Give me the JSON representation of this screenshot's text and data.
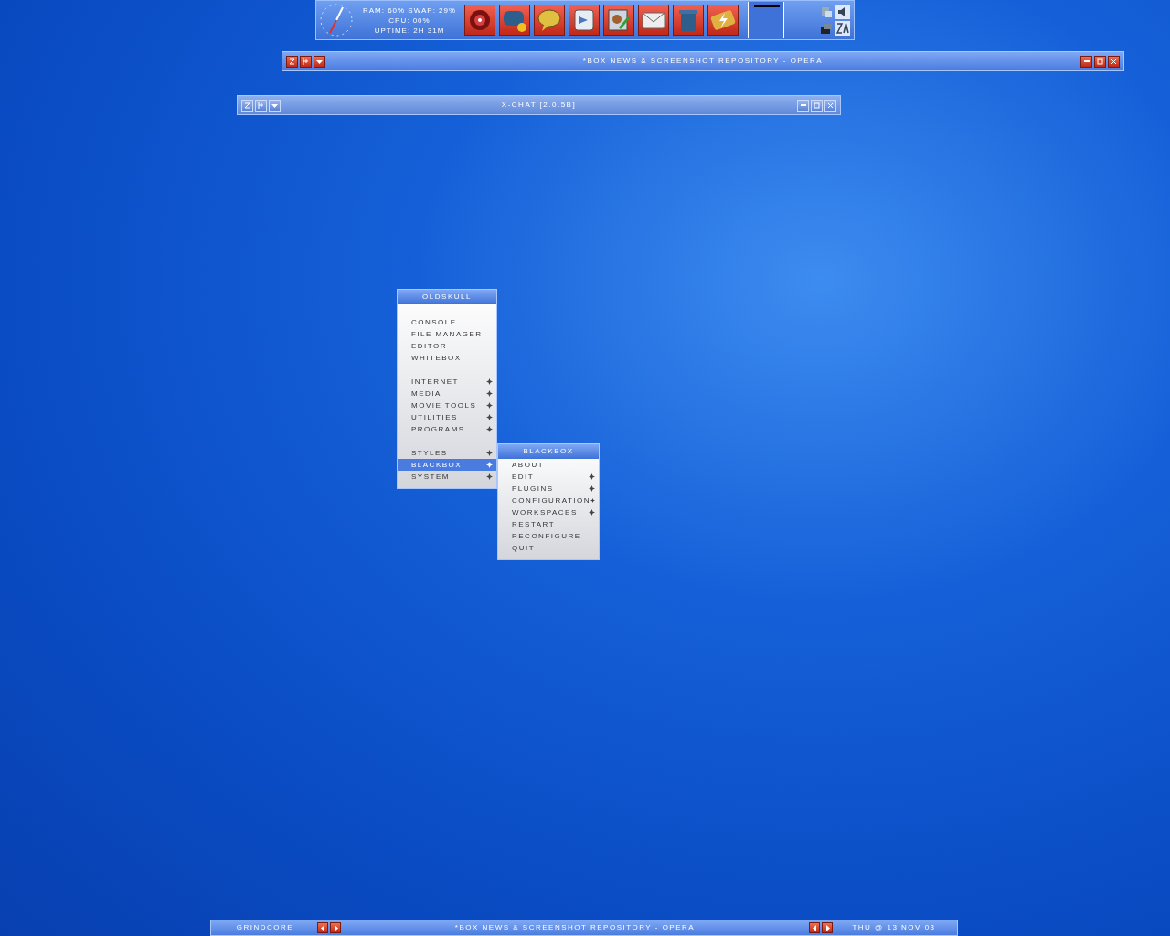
{
  "dock": {
    "sysinfo": [
      "RAM: 60% SWAP: 29%",
      "CPU: 00%",
      "UPTIME: 2H 31M"
    ]
  },
  "windows": [
    {
      "title": "*BOX NEWS & SCREENSHOT REPOSITORY - OPERA",
      "focused": true
    },
    {
      "title": "X-CHAT [2.0.5B]",
      "focused": false
    }
  ],
  "menu": {
    "title": "OLDSKULL",
    "items": [
      {
        "kind": "gap"
      },
      {
        "kind": "item",
        "label": "CONSOLE",
        "submenu": false,
        "selected": false
      },
      {
        "kind": "item",
        "label": "FILE MANAGER",
        "submenu": false,
        "selected": false
      },
      {
        "kind": "item",
        "label": "EDITOR",
        "submenu": false,
        "selected": false
      },
      {
        "kind": "item",
        "label": "WHITEBOX",
        "submenu": false,
        "selected": false
      },
      {
        "kind": "gap"
      },
      {
        "kind": "item",
        "label": "INTERNET",
        "submenu": true,
        "selected": false
      },
      {
        "kind": "item",
        "label": "MEDIA",
        "submenu": true,
        "selected": false
      },
      {
        "kind": "item",
        "label": "MOVIE TOOLS",
        "submenu": true,
        "selected": false
      },
      {
        "kind": "item",
        "label": "UTILITIES",
        "submenu": true,
        "selected": false
      },
      {
        "kind": "item",
        "label": "PROGRAMS",
        "submenu": true,
        "selected": false
      },
      {
        "kind": "gap"
      },
      {
        "kind": "item",
        "label": "STYLES",
        "submenu": true,
        "selected": false
      },
      {
        "kind": "item",
        "label": "BLACKBOX",
        "submenu": true,
        "selected": true
      },
      {
        "kind": "item",
        "label": "SYSTEM",
        "submenu": true,
        "selected": false
      }
    ]
  },
  "submenu": {
    "title": "BLACKBOX",
    "items": [
      {
        "kind": "item",
        "label": "ABOUT",
        "submenu": false,
        "selected": false
      },
      {
        "kind": "item",
        "label": "EDIT",
        "submenu": true,
        "selected": false
      },
      {
        "kind": "item",
        "label": "PLUGINS",
        "submenu": true,
        "selected": false
      },
      {
        "kind": "item",
        "label": "CONFIGURATION",
        "submenu": true,
        "selected": false
      },
      {
        "kind": "item",
        "label": "WORKSPACES",
        "submenu": true,
        "selected": false
      },
      {
        "kind": "item",
        "label": "RESTART",
        "submenu": false,
        "selected": false
      },
      {
        "kind": "item",
        "label": "RECONFIGURE",
        "submenu": false,
        "selected": false
      },
      {
        "kind": "item",
        "label": "QUIT",
        "submenu": false,
        "selected": false
      }
    ]
  },
  "toolbar": {
    "workspace": "GRINDCORE",
    "window_title": "*BOX NEWS & SCREENSHOT REPOSITORY - OPERA",
    "clock": "THU @ 13 NOV 03"
  }
}
